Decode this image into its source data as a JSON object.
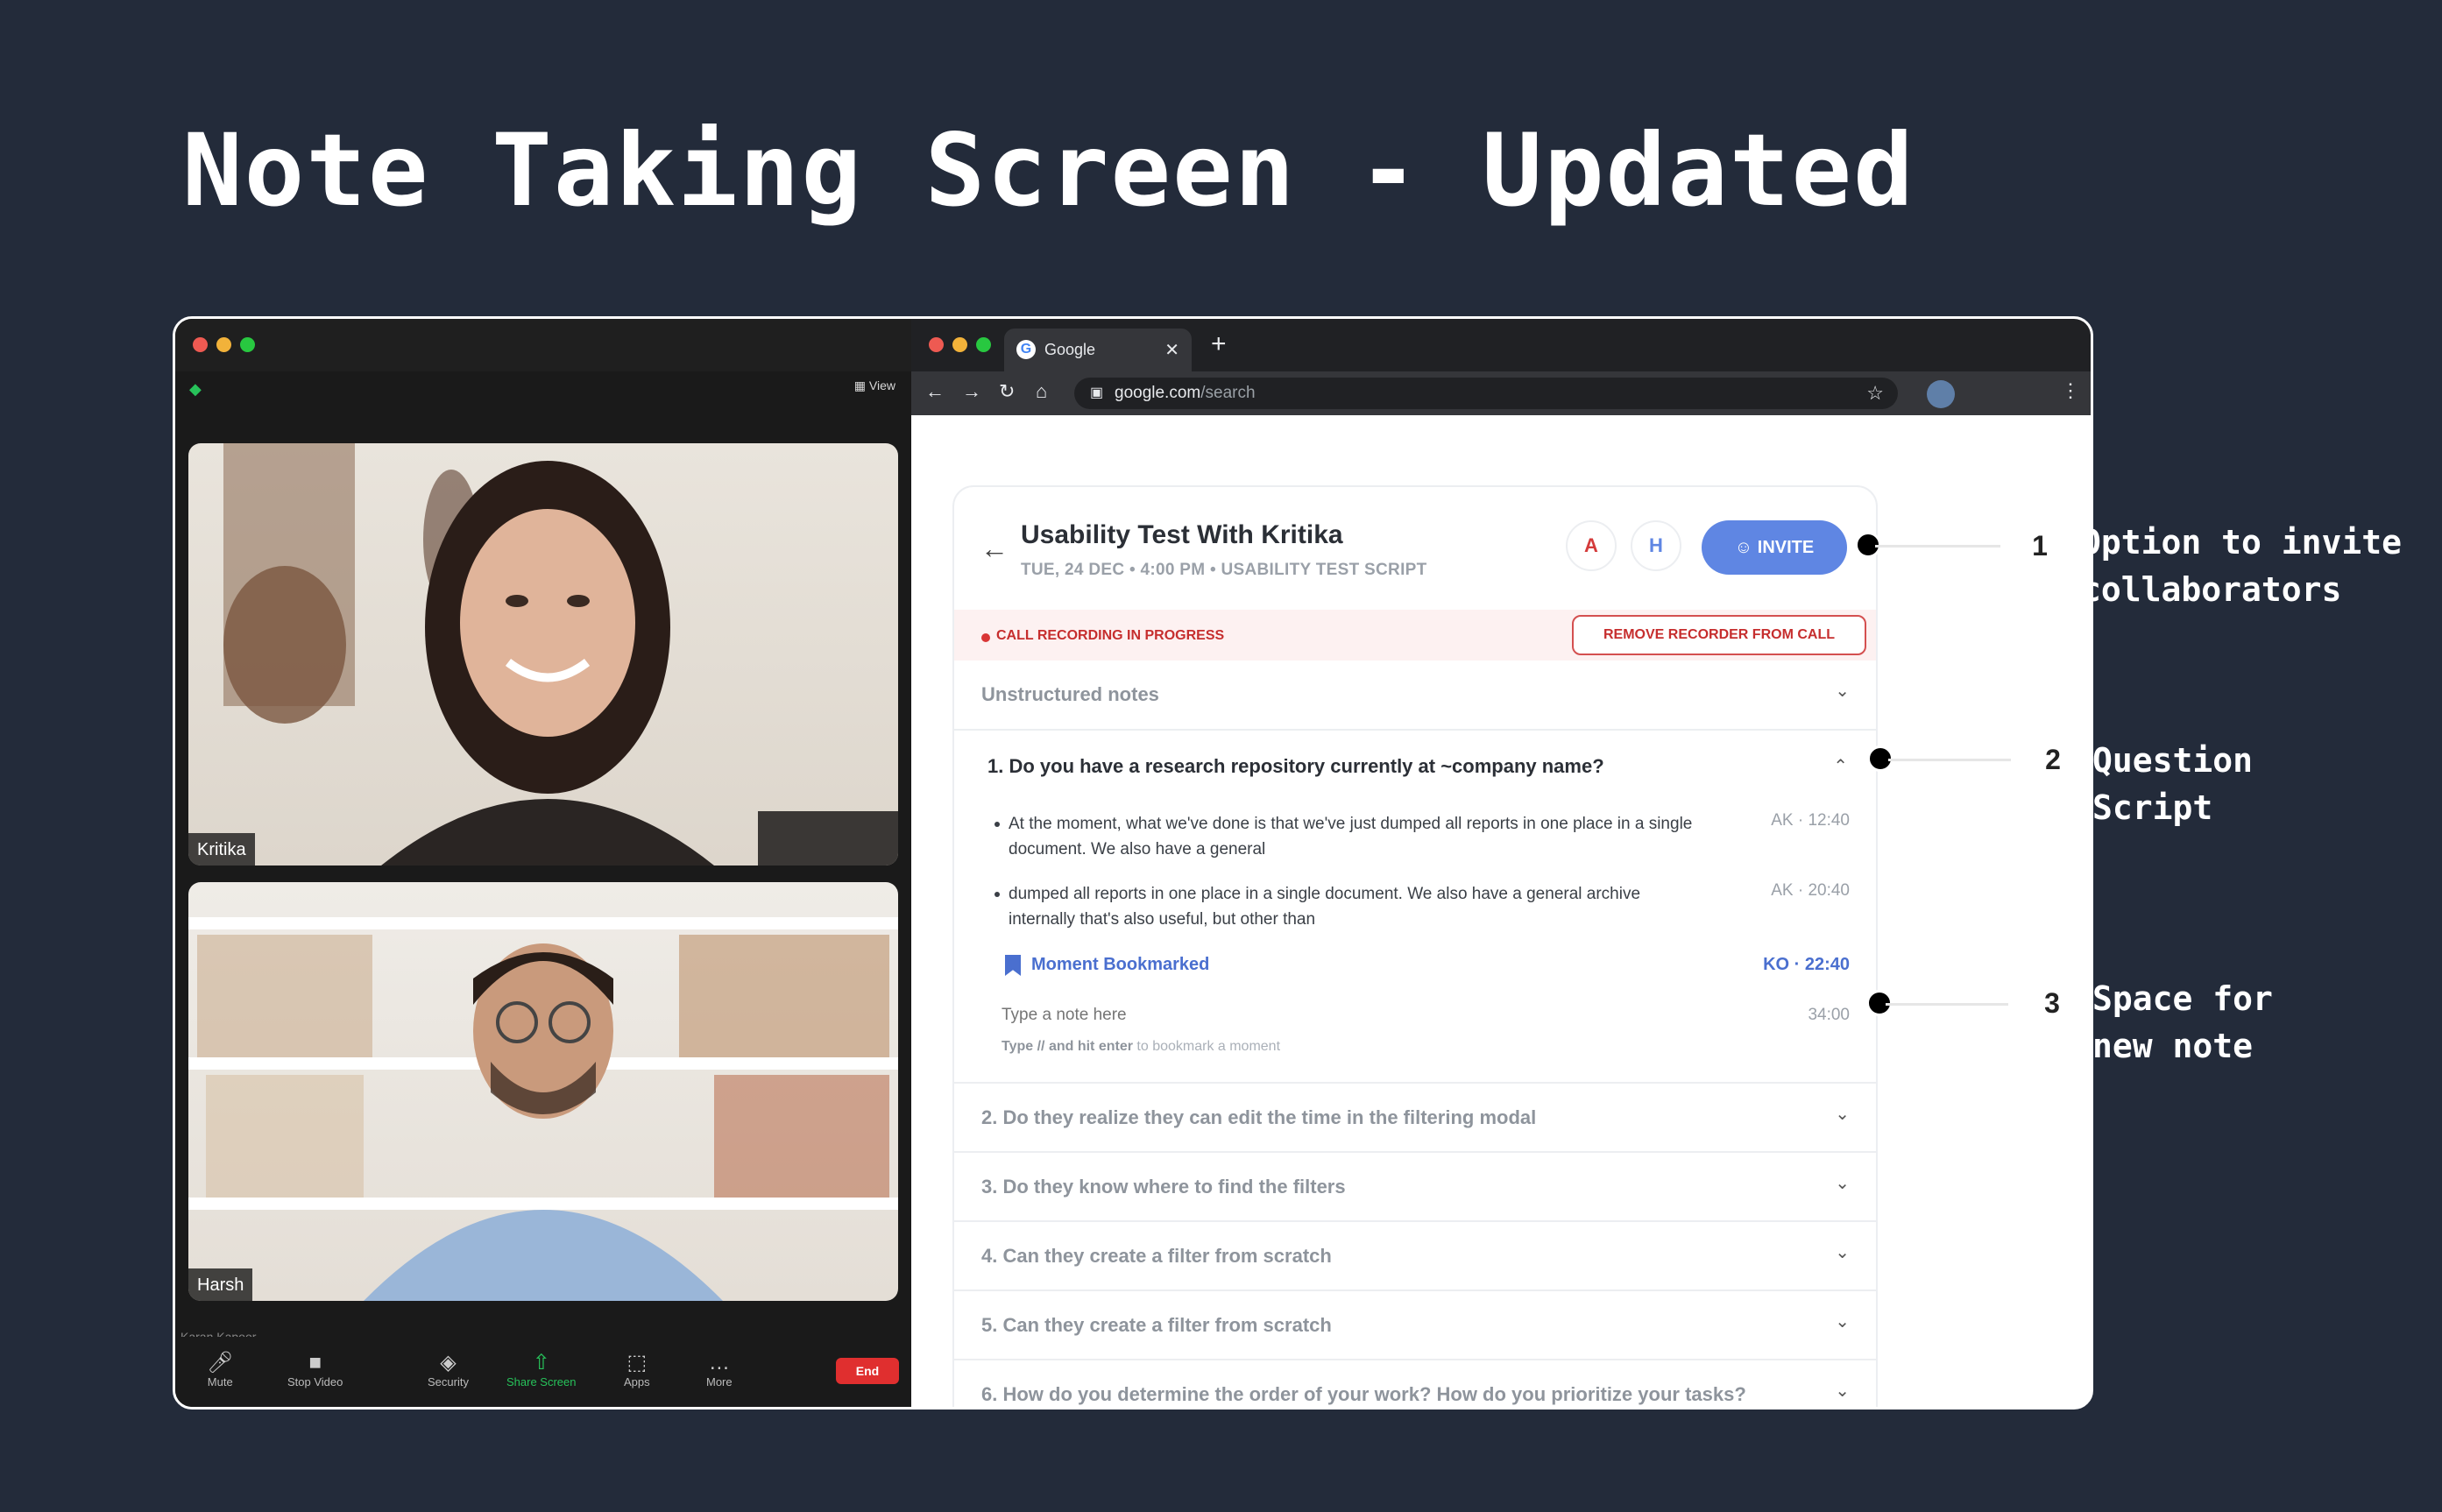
{
  "title": "Note Taking Screen - Updated",
  "zoom": {
    "view_label": "View",
    "participants": [
      "Kritika",
      "Harsh"
    ],
    "peek_name": "Karan Kapoor",
    "toolbar": [
      "Mute",
      "Stop Video",
      "Security",
      "Share Screen",
      "Apps",
      "More"
    ],
    "end_label": "End"
  },
  "browser": {
    "tab_title": "Google",
    "url_host": "google.com",
    "url_path": "/search"
  },
  "app": {
    "title": "Usability Test With Kritika",
    "subtitle": "TUE, 24 DEC • 4:00 PM • USABILITY TEST SCRIPT",
    "avatars": [
      "A",
      "H"
    ],
    "invite_label": "INVITE",
    "recording_status": "CALL RECORDING IN PROGRESS",
    "remove_recorder_label": "REMOVE RECORDER  FROM CALL",
    "unstructured_label": "Unstructured notes",
    "open_question": "1. Do you have a research repository currently at ~company name?",
    "notes": [
      {
        "text": "At the moment, what we've done is that we've just dumped all reports in one place in a single document. We also have a general",
        "stamp": "AK · 12:40"
      },
      {
        "text": "dumped all reports in one place in a single document. We also have a general archive internally that's also useful, but other than",
        "stamp": "AK · 20:40"
      }
    ],
    "bookmark_label": "Moment Bookmarked",
    "bookmark_stamp": "KO · 22:40",
    "note_placeholder": "Type a note here",
    "note_time": "34:00",
    "hint_bold": "Type // and hit enter",
    "hint_rest": " to bookmark a moment",
    "questions": [
      "2. Do they realize they can edit the time in the filtering modal",
      "3. Do they know where to find the filters",
      "4. Can they create a filter from scratch",
      "5. Can they create a filter from scratch",
      "6. How do you determine the order of your work? How do you prioritize your tasks?"
    ]
  },
  "annotations": [
    {
      "num": "1",
      "text": "Option to invite collaborators"
    },
    {
      "num": "2",
      "text": "Question Script"
    },
    {
      "num": "3",
      "text": "Space for new note"
    }
  ]
}
